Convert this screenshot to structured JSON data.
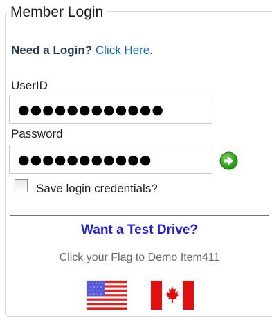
{
  "login": {
    "legend": "Member Login",
    "need_login_text": "Need a Login?",
    "click_here_link": "Click Here",
    "after_link": ".",
    "userid_label": "UserID",
    "userid_value": "●●●●●●●●●●●●",
    "password_label": "Password",
    "password_value": "●●●●●●●●●●●",
    "save_credentials_label": "Save login credentials?",
    "save_credentials_checked": false,
    "submit_icon": "green-arrow-icon"
  },
  "demo": {
    "heading": "Want a Test Drive?",
    "instruction": "Click your Flag to Demo Item411",
    "flags": [
      {
        "name": "us-flag-icon"
      },
      {
        "name": "canada-flag-icon"
      }
    ]
  },
  "colors": {
    "link": "#1a62c9",
    "heading": "#1f1fd9",
    "go_button": "#2e9e1e"
  }
}
